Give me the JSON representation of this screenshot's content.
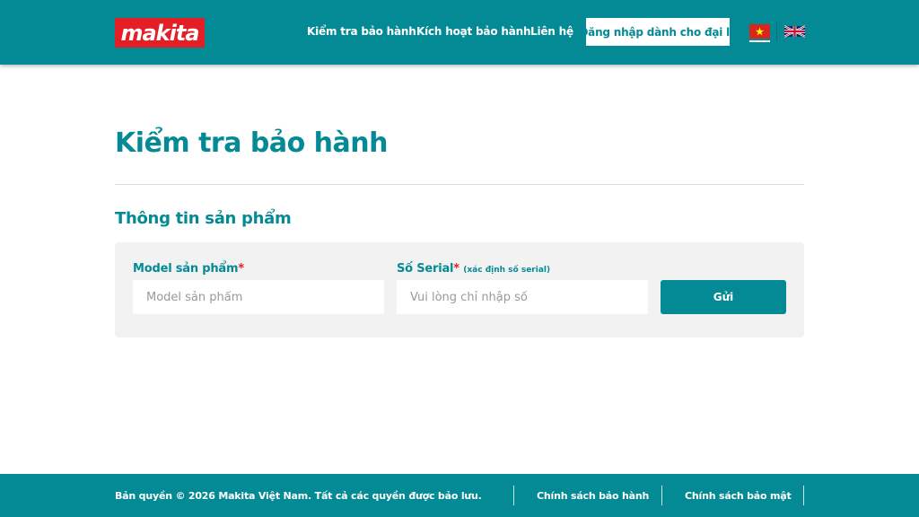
{
  "header": {
    "logo_text": "makita",
    "nav": [
      {
        "label": "Kiểm tra bảo hành"
      },
      {
        "label": "Kích hoạt bảo hành"
      },
      {
        "label": "Liên hệ"
      }
    ],
    "login_label": "Đăng nhập dành cho đại lý",
    "languages": [
      {
        "icon": "vietnam-flag-icon",
        "active": true
      },
      {
        "icon": "uk-flag-icon",
        "active": false
      }
    ]
  },
  "main": {
    "page_title": "Kiểm tra bảo hành",
    "section_title": "Thông tin sản phẩm",
    "form": {
      "model": {
        "label": "Model sản phẩm",
        "required_mark": "*",
        "placeholder": "Model sản phẩm",
        "value": ""
      },
      "serial": {
        "label": "Số Serial",
        "required_mark": "*",
        "hint": "(xác định số serial)",
        "placeholder": "Vui lòng chỉ nhập số",
        "value": ""
      },
      "submit_label": "Gửi"
    }
  },
  "footer": {
    "copyright": "Bản quyền © 2026 Makita Việt Nam. Tất cả các quyền được bảo lưu.",
    "links": [
      {
        "label": "Chính sách bảo hành"
      },
      {
        "label": "Chính sách bảo mật"
      }
    ]
  },
  "colors": {
    "brand_teal": "#048a95",
    "brand_red": "#e31e24",
    "form_background": "#f2f2f2"
  }
}
